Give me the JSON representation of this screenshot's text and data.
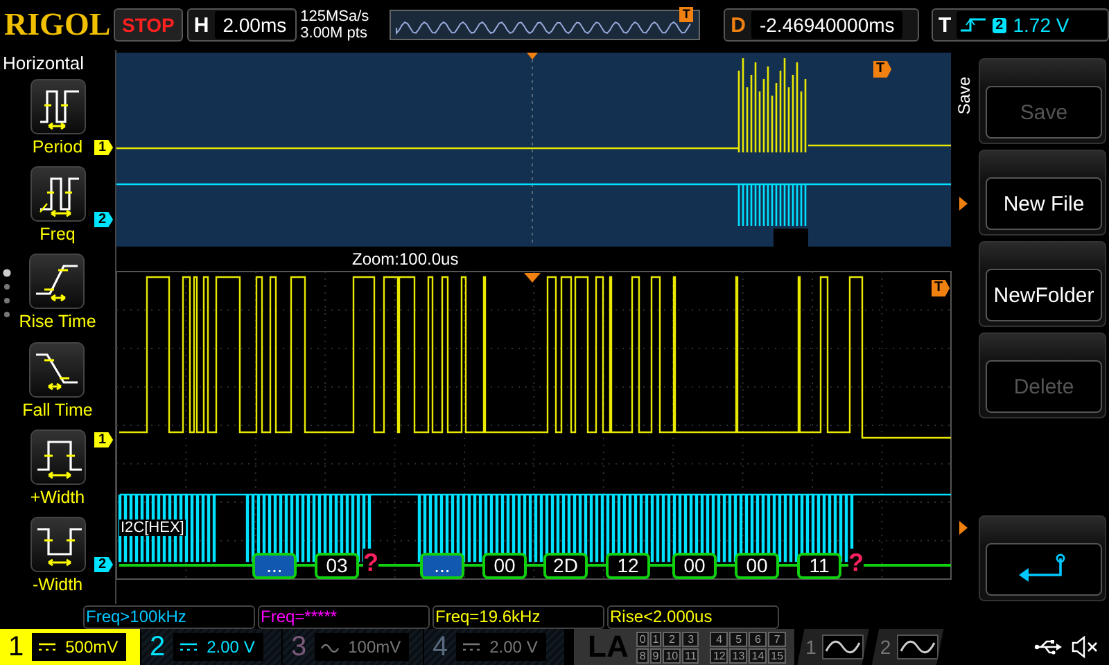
{
  "brand": "RIGOL",
  "run_state": "STOP",
  "timebase": {
    "label": "H",
    "value": "2.00ms"
  },
  "acquisition": {
    "sample_rate": "125MSa/s",
    "memory_depth": "3.00M pts"
  },
  "memory_overview": {
    "trigger_marker": "T"
  },
  "delay": {
    "label": "D",
    "value": "-2.46940000ms"
  },
  "trigger": {
    "label": "T",
    "source": "2",
    "level": "1.72 V"
  },
  "measure_menu": {
    "title": "Horizontal",
    "items": [
      {
        "label": "Period",
        "kind": "period"
      },
      {
        "label": "Freq",
        "kind": "freq"
      },
      {
        "label": "Rise Time",
        "kind": "rise"
      },
      {
        "label": "Fall Time",
        "kind": "fall"
      },
      {
        "label": "+Width",
        "kind": "pwidth"
      },
      {
        "label": "-Width",
        "kind": "nwidth"
      }
    ]
  },
  "display": {
    "overview_markers": [
      {
        "label": "1",
        "color": "#ffff00"
      },
      {
        "label": "2",
        "color": "#00e5ff"
      }
    ],
    "trigger_marker": "T",
    "zoom_label": "Zoom:100.0us",
    "zoom_markers": [
      {
        "label": "1",
        "color": "#ffff00"
      },
      {
        "label": "2",
        "color": "#00e5ff"
      }
    ],
    "zoom_trigger_marker": "T"
  },
  "decode": {
    "label": "I2C[HEX]",
    "packets": [
      {
        "kind": "address",
        "text": "..."
      },
      {
        "kind": "data",
        "text": "03"
      },
      {
        "kind": "error",
        "text": "?"
      },
      {
        "kind": "address",
        "text": "..."
      },
      {
        "kind": "data",
        "text": "00"
      },
      {
        "kind": "data",
        "text": "2D"
      },
      {
        "kind": "data",
        "text": "12"
      },
      {
        "kind": "data",
        "text": "00"
      },
      {
        "kind": "data",
        "text": "00"
      },
      {
        "kind": "data",
        "text": "11"
      },
      {
        "kind": "error",
        "text": "?"
      }
    ]
  },
  "measurements": [
    {
      "text": "Freq>100kHz",
      "color": "#00c8ff"
    },
    {
      "text": "Freq=*****",
      "color": "#ff00ff"
    },
    {
      "text": "Freq=19.6kHz",
      "color": "#ffff00"
    },
    {
      "text": "Rise<2.000us",
      "color": "#ffff00"
    }
  ],
  "softkeys": {
    "title": "Save",
    "buttons": [
      {
        "kind": "text",
        "label": "Save",
        "disabled": true
      },
      {
        "kind": "text",
        "label": "New File",
        "disabled": false
      },
      {
        "kind": "text",
        "label": "NewFolder",
        "disabled": false
      },
      {
        "kind": "text",
        "label": "Delete",
        "disabled": true
      },
      {
        "kind": "empty"
      },
      {
        "kind": "back"
      }
    ]
  },
  "channels": [
    {
      "number": "1",
      "kind": "dc",
      "scale": "500mV",
      "selected": true,
      "enabled": true,
      "color": "#000000"
    },
    {
      "number": "2",
      "kind": "dc",
      "scale": "2.00 V",
      "selected": false,
      "enabled": true,
      "color": "#00e5ff"
    },
    {
      "number": "3",
      "kind": "ac",
      "scale": "100mV",
      "selected": false,
      "enabled": false,
      "color": "#7a5a7a"
    },
    {
      "number": "4",
      "kind": "dc",
      "scale": "2.00 V",
      "selected": false,
      "enabled": false,
      "color": "#5a6a80"
    }
  ],
  "logic_analyzer": {
    "label": "LA",
    "bits": [
      "0",
      "1",
      "2",
      "3",
      "4",
      "5",
      "6",
      "7",
      "8",
      "9",
      "10",
      "11",
      "12",
      "13",
      "14",
      "15"
    ]
  },
  "generators": [
    {
      "number": "1"
    },
    {
      "number": "2"
    }
  ]
}
